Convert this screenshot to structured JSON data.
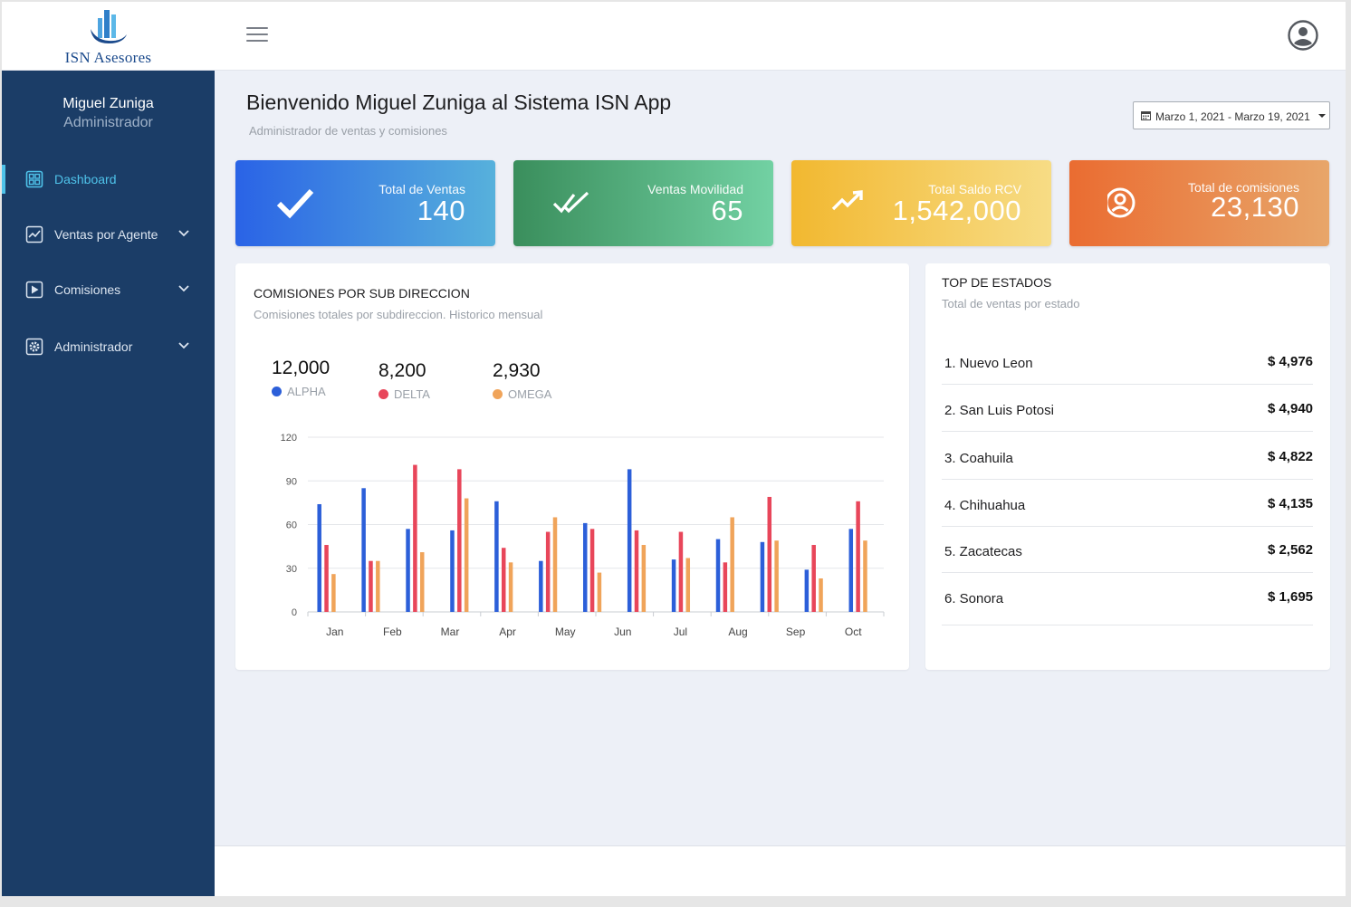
{
  "brand": {
    "name": "ISN Asesores"
  },
  "header": {
    "menu_icon": "hamburger-icon",
    "user_icon": "user-circle-icon"
  },
  "sidebar": {
    "user_name": "Miguel Zuniga",
    "user_role": "Administrador",
    "items": [
      {
        "label": "Dashboard",
        "icon": "grid-icon",
        "active": true
      },
      {
        "label": "Ventas por Agente",
        "icon": "trend-icon",
        "expandable": true
      },
      {
        "label": "Comisiones",
        "icon": "play-icon",
        "expandable": true
      },
      {
        "label": "Administrador",
        "icon": "gear-icon",
        "expandable": true
      }
    ],
    "active_color": "#4fc3ea",
    "background": "#1b3d67"
  },
  "page": {
    "title": "Bienvenido Miguel Zuniga al Sistema ISN App",
    "subtitle": "Administrador de ventas y comisiones",
    "date_range": "Marzo 1, 2021 - Marzo 19, 2021"
  },
  "stats": [
    {
      "label": "Total de Ventas",
      "value": "140",
      "icon": "check-icon",
      "colors": [
        "#2a63e6",
        "#57b1dc"
      ]
    },
    {
      "label": "Ventas Movilidad",
      "value": "65",
      "icon": "double-check-icon",
      "colors": [
        "#3a8e5c",
        "#72d1a3"
      ]
    },
    {
      "label": "Total Saldo RCV",
      "value": "1,542,000",
      "icon": "trending-up-icon",
      "colors": [
        "#f2b830",
        "#f7dc85"
      ]
    },
    {
      "label": "Total de comisiones",
      "value": "23,130",
      "icon": "user-circle-icon",
      "colors": [
        "#ea6c31",
        "#e8a66a"
      ]
    }
  ],
  "commissions": {
    "title": "COMISIONES POR SUB DIRECCION",
    "subtitle": "Comisiones totales por subdireccion. Historico mensual",
    "legend": [
      {
        "name": "ALPHA",
        "total": "12,000",
        "color": "#2c5fd9"
      },
      {
        "name": "DELTA",
        "total": "8,200",
        "color": "#e8465a"
      },
      {
        "name": "OMEGA",
        "total": "2,930",
        "color": "#f0a45a"
      }
    ]
  },
  "chart_data": {
    "type": "bar",
    "categories": [
      "Jan",
      "Feb",
      "Mar",
      "Apr",
      "May",
      "Jun",
      "Jul",
      "Aug",
      "Sep",
      "Oct"
    ],
    "series": [
      {
        "name": "ALPHA",
        "values": [
          74,
          85,
          57,
          56,
          76,
          35,
          61,
          98,
          36,
          50,
          48,
          29,
          57
        ]
      },
      {
        "name": "DELTA",
        "values": [
          46,
          35,
          101,
          98,
          44,
          55,
          57,
          56,
          55,
          34,
          79,
          46,
          76
        ]
      },
      {
        "name": "OMEGA",
        "values": [
          26,
          35,
          41,
          78,
          34,
          65,
          27,
          46,
          37,
          65,
          49,
          23,
          49
        ]
      }
    ],
    "colors": [
      "#2c5fd9",
      "#e8465a",
      "#f0a45a"
    ],
    "yticks": [
      0,
      30,
      60,
      90,
      120
    ],
    "ylim": [
      0,
      120
    ],
    "grid": true
  },
  "top_states": {
    "title": "TOP DE ESTADOS",
    "subtitle": "Total de ventas por estado",
    "rows": [
      {
        "name": "1. Nuevo Leon",
        "value": "$ 4,976"
      },
      {
        "name": "2. San Luis Potosi",
        "value": "$ 4,940"
      },
      {
        "name": "3. Coahuila",
        "value": "$ 4,822"
      },
      {
        "name": "4. Chihuahua",
        "value": "$ 4,135"
      },
      {
        "name": "5. Zacatecas",
        "value": "$ 2,562"
      },
      {
        "name": "6. Sonora",
        "value": "$ 1,695"
      }
    ]
  }
}
